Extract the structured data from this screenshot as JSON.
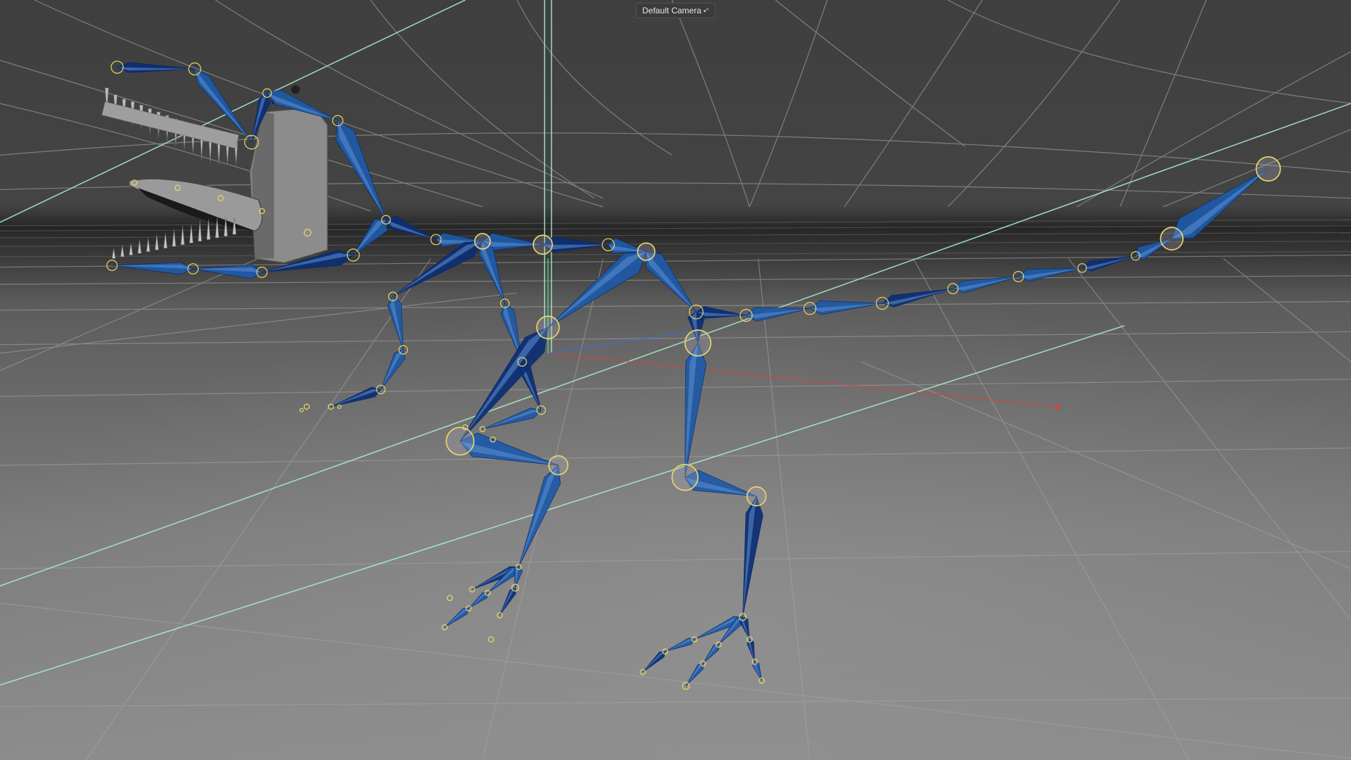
{
  "viewport": {
    "camera_label": "Default Camera",
    "camera_icon": "camera-dots-icon",
    "icon_glyph": "•°"
  },
  "colors": {
    "background_top": "#3f3f3f",
    "floor_near": "#8a8a8a",
    "grid_line": "#9a9a9a",
    "bone": "#1e5aa8",
    "bone_dark": "#0c2e74",
    "joint": "#e8d66a",
    "guide": "#9be8c8",
    "axis_x": "#d94040",
    "axis_y": "#56c48a"
  }
}
